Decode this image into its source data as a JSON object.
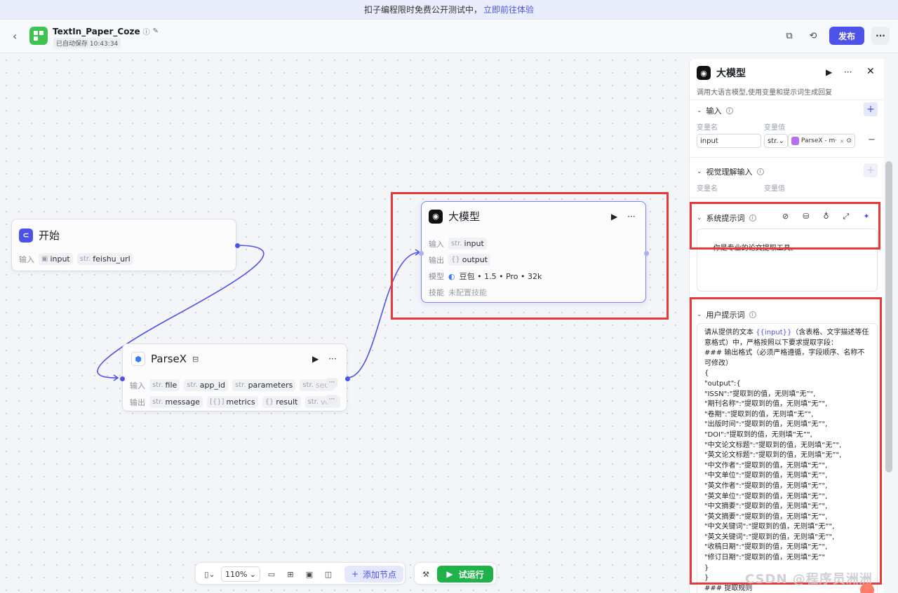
{
  "banner": {
    "text": "扣子编程限时免费公开测试中，",
    "link": "立即前往体验"
  },
  "header": {
    "title": "TextIn_Paper_Coze",
    "saved": "已自动保存 10:43:34",
    "publish": "发布",
    "icons": [
      "back-icon",
      "info-icon",
      "edit-icon",
      "copy-icon",
      "history-icon",
      "more-icon"
    ]
  },
  "nodes": {
    "start": {
      "title": "开始",
      "input_label": "输入",
      "inputs": [
        {
          "type": "",
          "name": "input"
        },
        {
          "type": "str.",
          "name": "feishu_url"
        }
      ]
    },
    "parsex": {
      "title": "ParseX",
      "input_label": "输入",
      "output_label": "输出",
      "inputs": [
        {
          "type": "str.",
          "name": "file"
        },
        {
          "type": "str.",
          "name": "app_id"
        },
        {
          "type": "str.",
          "name": "parameters"
        },
        {
          "type": "str.",
          "name": "secr"
        }
      ],
      "outputs": [
        {
          "type": "str.",
          "name": "message"
        },
        {
          "type": "[{}]",
          "name": "metrics"
        },
        {
          "type": "{}",
          "name": "result"
        },
        {
          "type": "str.",
          "name": "vers"
        }
      ],
      "more": "···"
    },
    "llm": {
      "title": "大模型",
      "input_label": "输入",
      "input_type": "str.",
      "input_name": "input",
      "output_label": "输出",
      "output_type": "{}",
      "output_name": "output",
      "model_label": "模型",
      "model_value": "豆包 • 1.5 • Pro • 32k",
      "skill_label": "技能",
      "skill_value": "未配置技能"
    }
  },
  "toolbar": {
    "zoom": "110%",
    "add_node": "添加节点",
    "run": "试运行"
  },
  "panel": {
    "title": "大模型",
    "desc": "调用大语言模型,使用变量和提示词生成回复",
    "input_section": "输入",
    "col_name": "变量名",
    "col_value": "变量值",
    "var_name": "input",
    "var_type": "str.",
    "var_ref": "ParseX - m···",
    "vision_section": "视觉理解输入",
    "vision_col_name": "变量名",
    "vision_col_value": "变量值",
    "system_prompt_title": "系统提示词",
    "system_prompt": "你是专业的论文提取工具。",
    "user_prompt_title": "用户提示词",
    "user_prompt_pre": "请从提供的文本 ",
    "user_prompt_var": "{{input}}",
    "user_prompt_body": "（含表格、文字描述等任意格式）中，严格按照以下要求提取字段：\n### 输出格式（必须严格遵循，字段顺序、名称不可修改）\n{\n\"output\":{\n\"ISSN\":\"提取到的值，无则填“无”\",\n\"期刊名称\":\"提取到的值，无则填“无”\",\n\"卷期\":\"提取到的值，无则填“无”\",\n\"出版时间\":\"提取到的值，无则填“无”\",\n\"DOI\":\"提取到的值，无则填“无”\",\n\"中文论文标题\":\"提取到的值，无则填“无”\",\n\"英文论文标题\":\"提取到的值，无则填“无”\",\n\"中文作者\":\"提取到的值，无则填“无”\",\n\"中文单位\":\"提取到的值，无则填“无”\",\n\"英文作者\":\"提取到的值，无则填“无”\",\n\"英文单位\":\"提取到的值，无则填“无”\",\n\"中文摘要\":\"提取到的值，无则填“无”\",\n\"英文摘要\":\"提取到的值，无则填“无”\",\n\"中文关键词\":\"提取到的值，无则填“无”\",\n\"英文关键词\":\"提取到的值，无则填“无”\",\n\"收稿日期\":\"提取到的值，无则填“无”\",\n\"修订日期\":\"提取到的值，无则填“无”\"\n}\n}\n### 提取规则"
  },
  "watermark": "CSDN @程序员洲洲",
  "colors": {
    "accent": "#4d53e8",
    "run": "#1fb24a",
    "highlight": "#e5393b",
    "start_icon": "#4d53e8",
    "app_logo": "#3ec254"
  }
}
